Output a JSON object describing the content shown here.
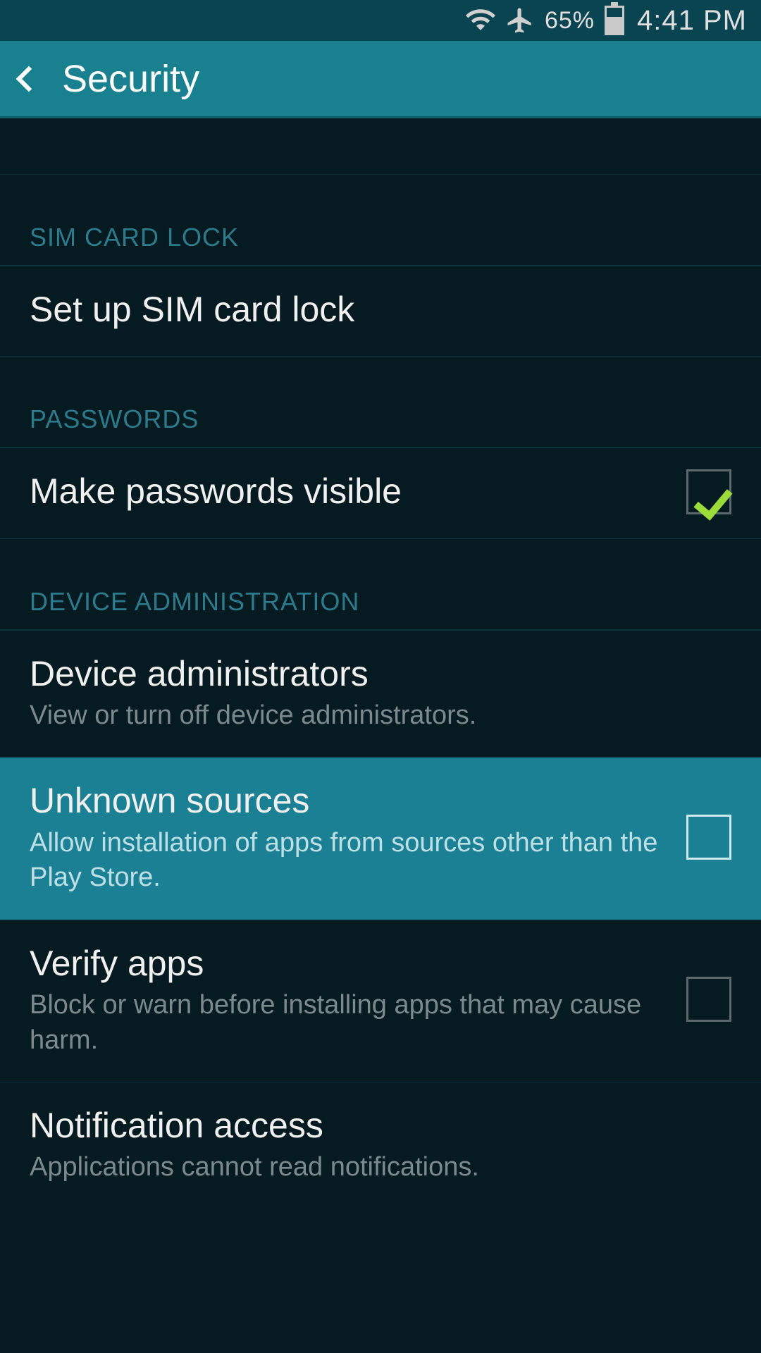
{
  "status": {
    "battery_pct": "65%",
    "time": "4:41 PM"
  },
  "header": {
    "title": "Security"
  },
  "sections": {
    "sim": {
      "header": "SIM CARD LOCK",
      "setup": "Set up SIM card lock"
    },
    "passwords": {
      "header": "PASSWORDS",
      "visible": "Make passwords visible"
    },
    "device_admin": {
      "header": "DEVICE ADMINISTRATION",
      "admins": {
        "title": "Device administrators",
        "sub": "View or turn off device administrators."
      },
      "unknown": {
        "title": "Unknown sources",
        "sub": "Allow installation of apps from sources other than the Play Store."
      },
      "verify": {
        "title": "Verify apps",
        "sub": "Block or warn before installing apps that may cause harm."
      },
      "notif": {
        "title": "Notification access",
        "sub": "Applications cannot read notifications."
      }
    }
  }
}
